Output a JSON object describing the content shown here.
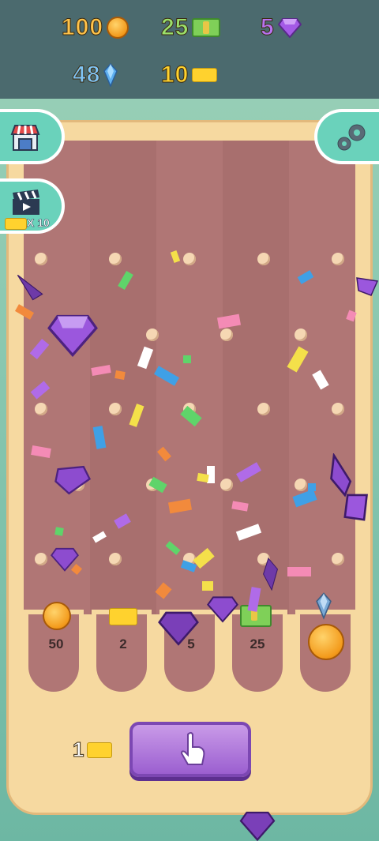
{
  "resources": {
    "coins": "100",
    "cash": "25",
    "gems": "5",
    "crystals": "48",
    "tickets": "10"
  },
  "side": {
    "video_reward_label": "X 10"
  },
  "slots": [
    {
      "label": "50",
      "prize": "coin-icon"
    },
    {
      "label": "2",
      "prize": "ticket-icon"
    },
    {
      "label": "5",
      "prize": "gem-icon"
    },
    {
      "label": "25",
      "prize": "cash-icon"
    },
    {
      "label": "",
      "prize": "crystal-icon"
    }
  ],
  "drop": {
    "cost": "1"
  },
  "colors": {
    "board": "#b07675",
    "frame": "#f6d9a0",
    "accent": "#6ad2bb",
    "button": "#9b5fd0"
  }
}
